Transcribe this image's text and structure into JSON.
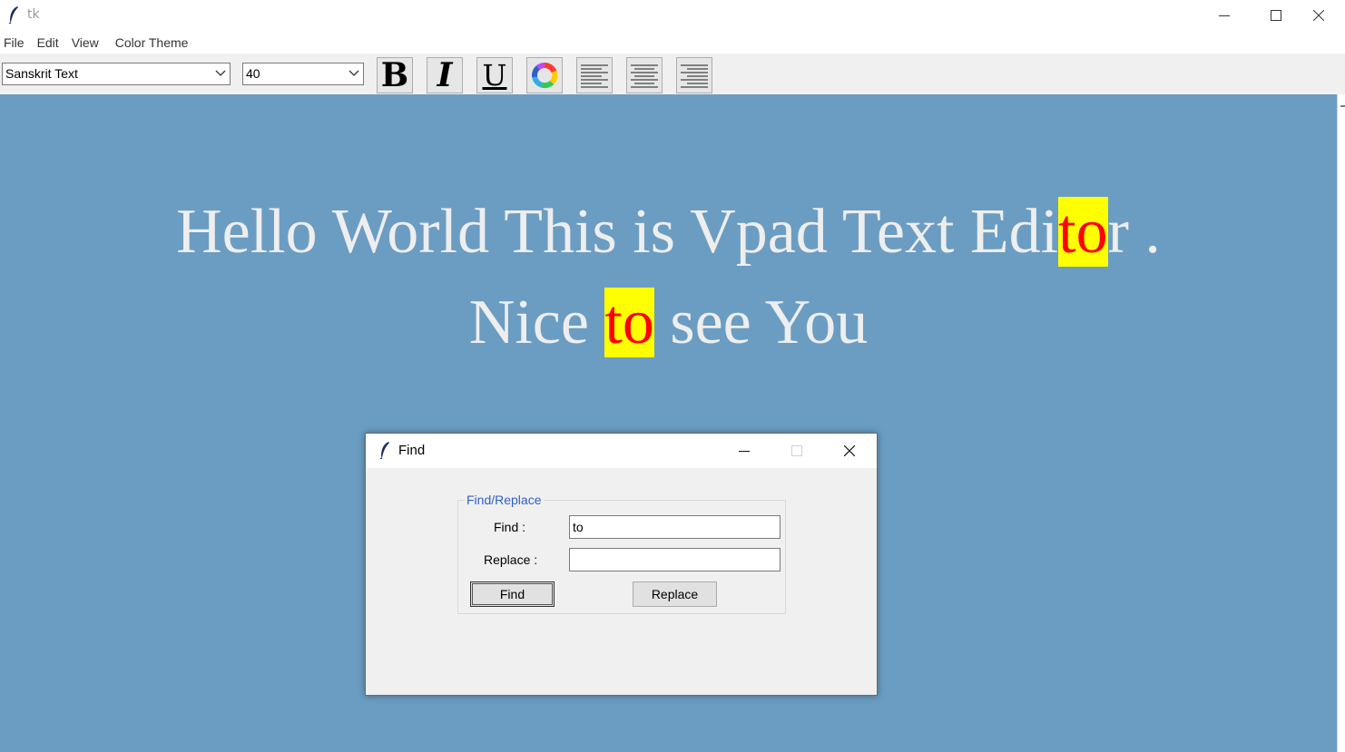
{
  "window": {
    "title": "tk",
    "controls": [
      "minimize-icon",
      "maximize-icon",
      "close-icon"
    ]
  },
  "menubar": {
    "items": [
      "File",
      "Edit",
      "View",
      "Color Theme"
    ]
  },
  "toolbar": {
    "font_family": "Sanskrit Text",
    "font_size": "40",
    "buttons": {
      "bold": "B",
      "italic": "I",
      "underline": "U"
    },
    "icons": [
      "bold-icon",
      "italic-icon",
      "underline-icon",
      "color-wheel-icon",
      "align-left-icon",
      "align-center-icon",
      "align-right-icon"
    ]
  },
  "editor": {
    "background": "#6b9dc3",
    "text_color": "#eeeeee",
    "highlight_bg": "#ffff00",
    "highlight_fg": "#ff0000",
    "line1": {
      "before": "Hello World This is Vpad Text Edi",
      "match": "to",
      "after": "r ."
    },
    "line2": {
      "before": "Nice ",
      "match": "to",
      "after": " see You"
    }
  },
  "find_dialog": {
    "title": "Find",
    "group_label": "Find/Replace",
    "find_label": "Find :",
    "find_value": "to",
    "replace_label": "Replace :",
    "replace_value": "",
    "find_button": "Find",
    "replace_button": "Replace",
    "legend_color": "#2f5fc7"
  }
}
